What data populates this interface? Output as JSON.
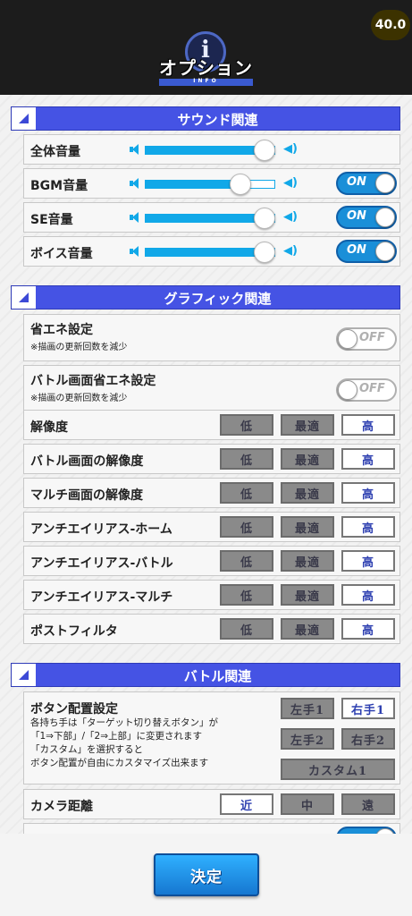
{
  "header": {
    "title": "オプション",
    "subtitle": "INFO",
    "emblem_icon": "info-icon",
    "fps_badge": "40.0"
  },
  "sections": {
    "sound": {
      "title": "サウンド関連",
      "rows": [
        {
          "label": "全体音量",
          "level": 0.92,
          "toggle": null
        },
        {
          "label": "BGM音量",
          "level": 0.73,
          "toggle": "ON"
        },
        {
          "label": "SE音量",
          "level": 0.92,
          "toggle": "ON"
        },
        {
          "label": "ボイス音量",
          "level": 0.92,
          "toggle": "ON"
        }
      ]
    },
    "graphics": {
      "title": "グラフィック関連",
      "eco": [
        {
          "label": "省エネ設定",
          "note": "※描画の更新回数を減少",
          "toggle": "OFF"
        },
        {
          "label": "バトル画面省エネ設定",
          "note": "※描画の更新回数を減少",
          "toggle": "OFF"
        }
      ],
      "quality_rows": [
        {
          "label": "解像度"
        },
        {
          "label": "バトル画面の解像度"
        },
        {
          "label": "マルチ画面の解像度"
        },
        {
          "label": "アンチエイリアス-ホーム"
        },
        {
          "label": "アンチエイリアス-バトル"
        },
        {
          "label": "アンチエイリアス-マルチ"
        },
        {
          "label": "ポストフィルタ"
        }
      ],
      "options": {
        "low": "低",
        "optimal": "最適",
        "high": "高",
        "selected": "高"
      }
    },
    "battle": {
      "title": "バトル関連",
      "button_layout": {
        "label": "ボタン配置設定",
        "description": [
          "各持ち手は「ターゲット切り替えボタン」が",
          "「1⇒下部」/「2⇒上部」に変更されます",
          "「カスタム」を選択すると",
          "ボタン配置が自由にカスタマイズ出来ます"
        ],
        "left1": "左手1",
        "right1": "右手1",
        "left2": "左手2",
        "right2": "右手2",
        "custom": "カスタム1",
        "selected": "右手1"
      },
      "camera": {
        "label": "カメラ距離",
        "near": "近",
        "mid": "中",
        "far": "遠",
        "selected": "近"
      }
    }
  },
  "footer": {
    "confirm_label": "決定"
  },
  "colors": {
    "section_header": "#4553e4",
    "slider": "#11a8e8",
    "toggle_on": "#1a8fd8",
    "confirm_button": "#1e90e8"
  }
}
